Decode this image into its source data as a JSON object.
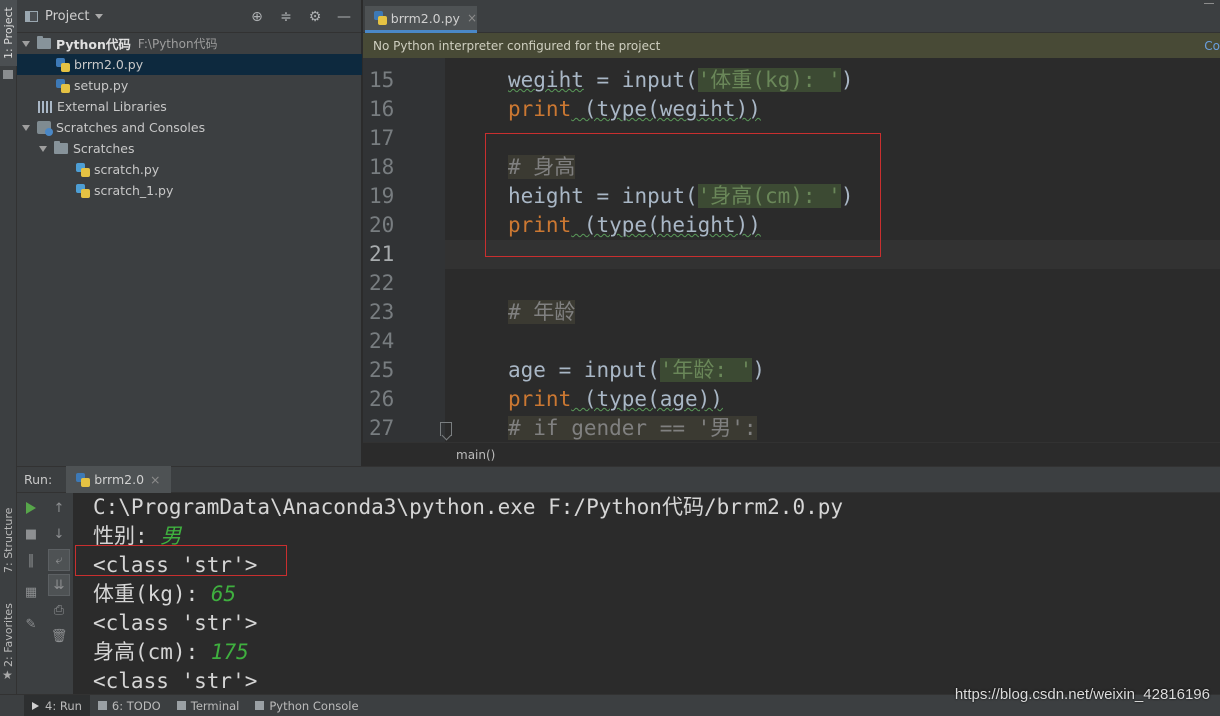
{
  "left_strip": {
    "project_tab": "1: Project",
    "structure_tab": "7: Structure",
    "favorites_tab": "2: Favorites"
  },
  "project_panel": {
    "title": "Project",
    "tree": [
      {
        "label": "Python代码",
        "hint": "F:\\Python代码",
        "type": "root"
      },
      {
        "label": "brrm2.0.py",
        "type": "py",
        "selected": true
      },
      {
        "label": "setup.py",
        "type": "py"
      },
      {
        "label": "External Libraries",
        "type": "lib"
      },
      {
        "label": "Scratches and Consoles",
        "type": "scratches"
      },
      {
        "label": "Scratches",
        "type": "folder"
      },
      {
        "label": "scratch.py",
        "type": "scratch"
      },
      {
        "label": "scratch_1.py",
        "type": "scratch"
      }
    ]
  },
  "editor": {
    "tab_label": "brrm2.0.py",
    "banner": "No Python interpreter configured for the project",
    "banner_link": "Co",
    "line_numbers": [
      "15",
      "16",
      "17",
      "18",
      "19",
      "20",
      "21",
      "22",
      "23",
      "24",
      "25",
      "26",
      "27"
    ],
    "code": {
      "l15_var": "wegiht",
      "l15_eq": " = ",
      "l15_fn": "input(",
      "l15_str": "'体重(kg): '",
      "l15_end": ")",
      "l16_kw": "print",
      "l16_rest": " (type(wegiht))",
      "l18_cmt": "# 身高",
      "l19_var": "height",
      "l19_eq": " = ",
      "l19_fn": "input(",
      "l19_str": "'身高(cm): '",
      "l19_end": ")",
      "l20_kw": "print",
      "l20_rest": " (type(height))",
      "l23_cmt": "# 年龄",
      "l25_var": "age",
      "l25_eq": " = ",
      "l25_fn": "input(",
      "l25_str": "'年龄: '",
      "l25_end": ")",
      "l26_kw": "print",
      "l26_rest": " (type(age))",
      "l27_cmt": "# if gender == '男':"
    },
    "breadcrumb": "main()"
  },
  "run_panel": {
    "label": "Run:",
    "tab_label": "brrm2.0",
    "output": [
      {
        "text": "C:\\ProgramData\\Anaconda3\\python.exe F:/Python代码/brrm2.0.py",
        "input": ""
      },
      {
        "text": "性别: ",
        "input": "男"
      },
      {
        "text": "<class 'str'>",
        "input": ""
      },
      {
        "text": "体重(kg): ",
        "input": "65"
      },
      {
        "text": "<class 'str'>",
        "input": ""
      },
      {
        "text": "身高(cm): ",
        "input": "175"
      },
      {
        "text": "<class 'str'>",
        "input": ""
      }
    ]
  },
  "statusbar": {
    "run": "4: Run",
    "todo": "6: TODO",
    "terminal": "Terminal",
    "python_console": "Python Console",
    "watermark": "https://blog.csdn.net/weixin_42816196"
  },
  "colors": {
    "keyword": "#cc7832",
    "string": "#6a8759",
    "comment": "#808080",
    "input_echo": "#3fb03f",
    "highlight_box": "#c92f2f"
  }
}
